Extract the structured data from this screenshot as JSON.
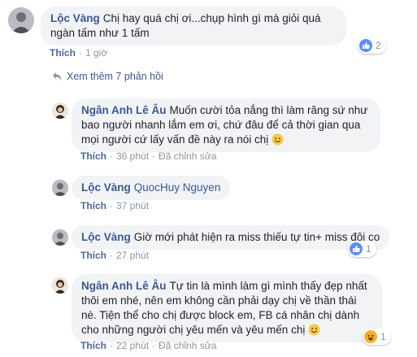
{
  "comments": [
    {
      "author": "Lộc Vàng",
      "text": "Chị hay quá chị ơi...chụp hình gì mà giỏi quá ngàn tấm như 1 tấm",
      "like_label": "Thích",
      "time": "1 giờ",
      "reaction_icon": "like-icon",
      "reaction_count": "2"
    }
  ],
  "view_more": "Xem thêm 7 phản hồi",
  "replies": [
    {
      "author": "Ngân Anh Lê Âu",
      "text": "Muốn cười tỏa nắng thì làm răng sứ như bao người nhanh lắm em ơi, chứ đâu để cả thời gian qua mọi người cứ lấy vấn đề này ra nói chị",
      "like_label": "Thích",
      "time": "36 phút",
      "edited": "Đã chỉnh sửa"
    },
    {
      "author": "Lộc Vàng",
      "tag": "QuocHuy Nguyen",
      "like_label": "Thích",
      "time": "37 phút"
    },
    {
      "author": "Lộc Vàng",
      "text": "Giờ mới phát hiện ra miss thiếu tự tin+ miss đôi co",
      "like_label": "Thích",
      "time": "27 phút",
      "reaction_icon": "like-icon",
      "reaction_count": "1"
    },
    {
      "author": "Ngân Anh Lê Âu",
      "text": "Tự tin là mình làm gì mình thấy đẹp nhất thôi em nhé, nên em không cần phải dạy chị về thần thái nè. Tiện thể cho chị được block em, FB cá nhân chị dành cho những người chị yêu mến và yêu mến chị",
      "like_label": "Thích",
      "time": "22 phút",
      "edited": "Đã chỉnh sửa",
      "reaction_icon": "haha-icon",
      "reaction_count": "1"
    }
  ],
  "colors": {
    "link": "#385898",
    "bubble": "#f2f3f5",
    "meta": "#90949c",
    "like_blue": "#5890ff",
    "haha_yellow": "#f7b125"
  }
}
